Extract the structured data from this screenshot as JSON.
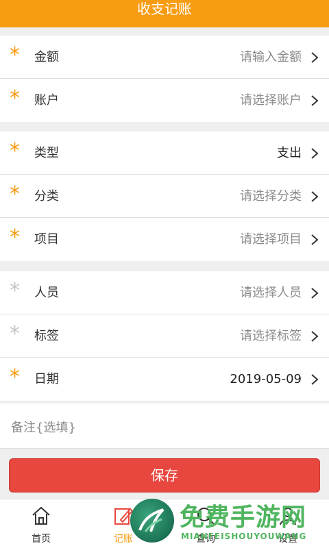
{
  "header": {
    "title": "收支记账"
  },
  "sections": [
    {
      "rows": [
        {
          "label": "金额",
          "value": "请输入金额",
          "required": true,
          "filled": false
        },
        {
          "label": "账户",
          "value": "请选择账户",
          "required": true,
          "filled": false
        }
      ]
    },
    {
      "rows": [
        {
          "label": "类型",
          "value": "支出",
          "required": true,
          "filled": true
        },
        {
          "label": "分类",
          "value": "请选择分类",
          "required": true,
          "filled": false
        },
        {
          "label": "项目",
          "value": "请选择项目",
          "required": true,
          "filled": false
        }
      ]
    },
    {
      "rows": [
        {
          "label": "人员",
          "value": "请选择人员",
          "required": false,
          "filled": false
        },
        {
          "label": "标签",
          "value": "请选择标签",
          "required": false,
          "filled": false
        },
        {
          "label": "日期",
          "value": "2019-05-09",
          "required": true,
          "filled": true
        }
      ]
    }
  ],
  "required_mark": "*",
  "note": {
    "placeholder": "备注{选填}"
  },
  "save_label": "保存",
  "tabs": [
    {
      "label": "首页",
      "icon": "home-icon",
      "active": false
    },
    {
      "label": "记账",
      "icon": "edit-icon",
      "active": true
    },
    {
      "label": "查询",
      "icon": "search-icon",
      "active": false
    },
    {
      "label": "设置",
      "icon": "user-icon",
      "active": false
    }
  ],
  "watermark": {
    "title": "免费手游网",
    "subtitle": "MIANFEISHOUYOUWANG"
  },
  "colors": {
    "accent": "#f89c12",
    "save": "#e8473f",
    "watermark": "#4fb55f"
  }
}
